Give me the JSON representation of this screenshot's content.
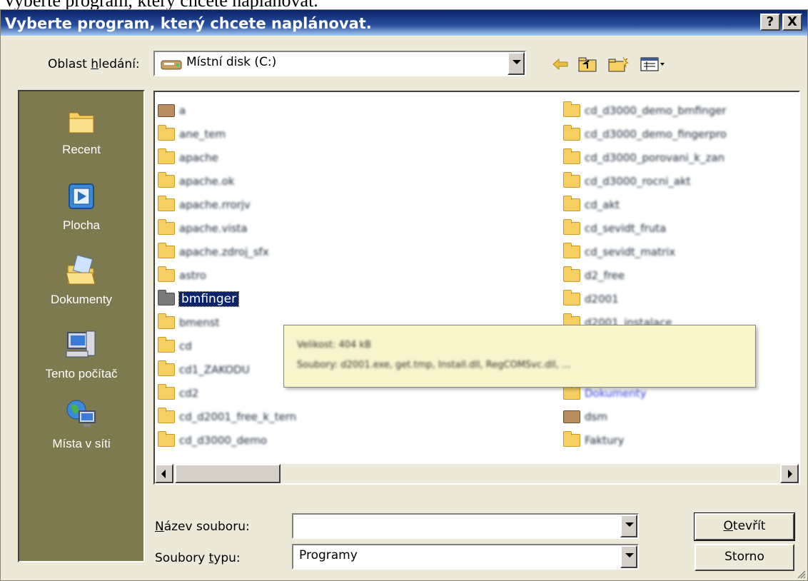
{
  "top_note": "Vyberte program, který chcete naplánovat.",
  "title": "Vyberte program, který chcete naplánovat.",
  "titlebar_buttons": {
    "help": "?",
    "close": "X"
  },
  "look_in": {
    "label_prefix": "Oblast ",
    "label_accel": "h",
    "label_suffix": "ledání:",
    "value": "Místní disk (C:)"
  },
  "places": [
    {
      "label": "Recent",
      "icon": "recent-folder-icon"
    },
    {
      "label": "Plocha",
      "icon": "desktop-icon"
    },
    {
      "label": "Dokumenty",
      "icon": "documents-icon"
    },
    {
      "label": "Tento počítač",
      "icon": "my-computer-icon"
    },
    {
      "label": "Místa v síti",
      "icon": "network-places-icon"
    }
  ],
  "files_left": [
    "a",
    "ane_tem",
    "apache",
    "apache.ok",
    "apache.rrorjv",
    "apache.vista",
    "apache.zdroj_sfx",
    "astro",
    "bmfinger",
    "bmenst",
    "cd",
    "cd1_ZAKODU",
    "cd2",
    "cd_d2001_free_k_tern",
    "cd_d3000_demo"
  ],
  "files_right": [
    "cd_d3000_demo_bmfinger",
    "cd_d3000_demo_fingerpro",
    "cd_d3000_porovani_k_zan",
    "cd_d3000_rocni_akt",
    "cd_akt",
    "cd_sevidt_fruta",
    "cd_sevidt_matrix",
    "d2_free",
    "d2001",
    "d2001_instalace",
    "",
    "",
    "Dokumenty",
    "dsm",
    "Faktury"
  ],
  "selected_file": "bmfinger",
  "tooltip": {
    "line1": "Velikost: 404 kB",
    "line2": "Soubory: d2001.exe, get.tmp, Install.dll, RegCOMSvc.dll, ..."
  },
  "filename": {
    "label_accel": "N",
    "label_rest": "ázev souboru:",
    "value": ""
  },
  "filetype": {
    "label_prefix": "Soubory ",
    "label_accel": "t",
    "label_suffix": "ypu:",
    "value": "Programy"
  },
  "buttons": {
    "open_accel": "O",
    "open_rest": "tevřít",
    "cancel": "Storno"
  },
  "colors": {
    "title_start": "#0a246a",
    "title_end": "#a6caf0",
    "places_bg": "#7d7a4f",
    "dialog_bg": "#ece9d8",
    "selection": "#0a246a"
  }
}
